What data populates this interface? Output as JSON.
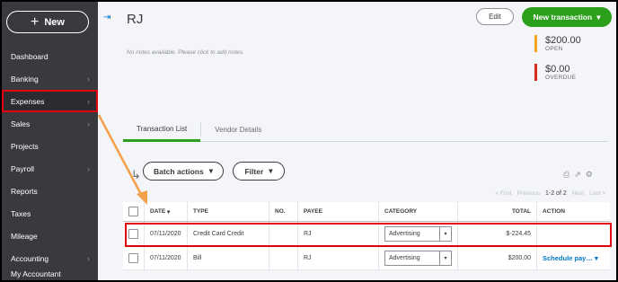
{
  "sidebar": {
    "new_button": "New",
    "items": [
      {
        "label": "Dashboard",
        "chevron": false
      },
      {
        "label": "Banking",
        "chevron": true
      },
      {
        "label": "Expenses",
        "chevron": true,
        "active": true
      },
      {
        "label": "Sales",
        "chevron": true
      },
      {
        "label": "Projects",
        "chevron": false
      },
      {
        "label": "Payroll",
        "chevron": true
      },
      {
        "label": "Reports",
        "chevron": false
      },
      {
        "label": "Taxes",
        "chevron": false
      },
      {
        "label": "Mileage",
        "chevron": false
      },
      {
        "label": "Accounting",
        "chevron": true
      },
      {
        "label": "My Accountant",
        "chevron": false
      }
    ]
  },
  "header": {
    "vendor_name": "RJ",
    "notes_placeholder": "No notes available. Please click to add notes.",
    "edit_label": "Edit",
    "new_transaction_label": "New transaction"
  },
  "summary": {
    "open_amount": "$200.00",
    "open_label": "OPEN",
    "overdue_amount": "$0.00",
    "overdue_label": "OVERDUE",
    "open_color": "#f4a623",
    "overdue_color": "#d52b1e"
  },
  "tabs": [
    "Transaction List",
    "Vendor Details"
  ],
  "toolbar": {
    "batch_actions": "Batch actions",
    "filter": "Filter"
  },
  "pager": {
    "first": "< First",
    "previous": "Previous",
    "range": "1-2 of 2",
    "next": "Next",
    "last": "Last >"
  },
  "table": {
    "headers": {
      "date": "DATE",
      "type": "TYPE",
      "no": "NO.",
      "payee": "PAYEE",
      "category": "CATEGORY",
      "total": "TOTAL",
      "action": "ACTION"
    },
    "rows": [
      {
        "date": "07/11/2020",
        "type": "Credit Card Credit",
        "no": "",
        "payee": "RJ",
        "category": "Advertising",
        "total": "$-224.45",
        "action": ""
      },
      {
        "date": "07/11/2020",
        "type": "Bill",
        "no": "",
        "payee": "RJ",
        "category": "Advertising",
        "total": "$200.00",
        "action": "Schedule pay…"
      }
    ]
  },
  "colors": {
    "sidebar_bg": "#393a3d",
    "brand_green": "#2ca01c",
    "link_blue": "#0077c5",
    "highlight_red": "#e3000f",
    "annotation_orange": "#f4a04a"
  }
}
